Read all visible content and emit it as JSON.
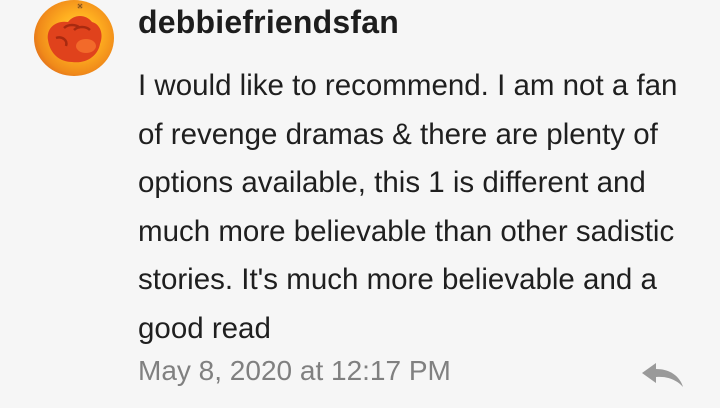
{
  "comment": {
    "avatar_icon": "fist-emoji-avatar",
    "username": "debbiefriendsfan",
    "text": "I would like to recommend. I am not a fan of revenge dramas & there are plenty of options available, this 1 is different and much more believable than other sadistic stories. It's much more believable and a good read",
    "timestamp": "May 8, 2020 at 12:17 PM",
    "reply_icon": "reply-arrow-icon"
  }
}
